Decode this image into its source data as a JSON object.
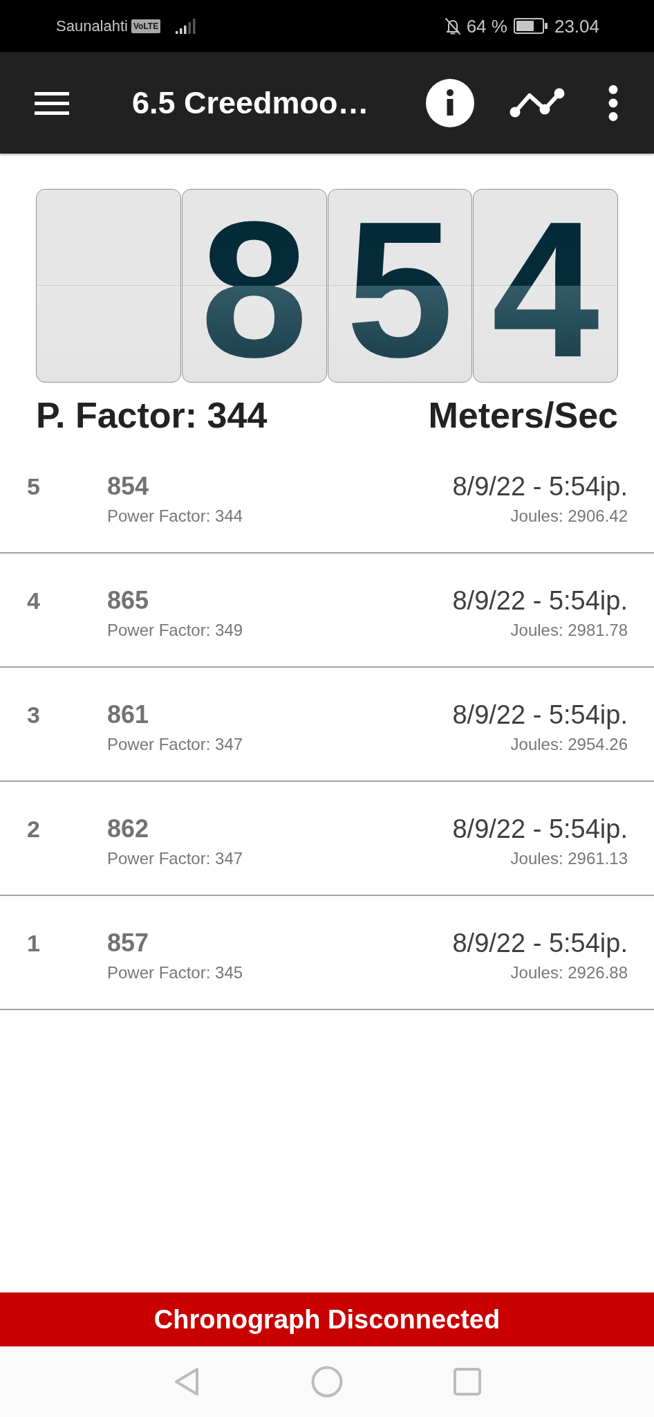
{
  "status_bar": {
    "carrier": "Saunalahti",
    "network_badge": "VoLTE",
    "battery": "64 %",
    "time": "23.04"
  },
  "app_bar": {
    "title": "6.5 Creedmoo…"
  },
  "display": {
    "digits": [
      "8",
      "5",
      "4"
    ],
    "power_factor": "P. Factor: 344",
    "units": "Meters/Sec"
  },
  "shots": [
    {
      "number": "5",
      "velocity": "854",
      "power_factor": "Power Factor: 344",
      "timestamp": "8/9/22 - 5:54ip.",
      "joules": "Joules: 2906.42"
    },
    {
      "number": "4",
      "velocity": "865",
      "power_factor": "Power Factor: 349",
      "timestamp": "8/9/22 - 5:54ip.",
      "joules": "Joules: 2981.78"
    },
    {
      "number": "3",
      "velocity": "861",
      "power_factor": "Power Factor: 347",
      "timestamp": "8/9/22 - 5:54ip.",
      "joules": "Joules: 2954.26"
    },
    {
      "number": "2",
      "velocity": "862",
      "power_factor": "Power Factor: 347",
      "timestamp": "8/9/22 - 5:54ip.",
      "joules": "Joules: 2961.13"
    },
    {
      "number": "1",
      "velocity": "857",
      "power_factor": "Power Factor: 345",
      "timestamp": "8/9/22 - 5:54ip.",
      "joules": "Joules: 2926.88"
    }
  ],
  "banner": "Chronograph Disconnected"
}
